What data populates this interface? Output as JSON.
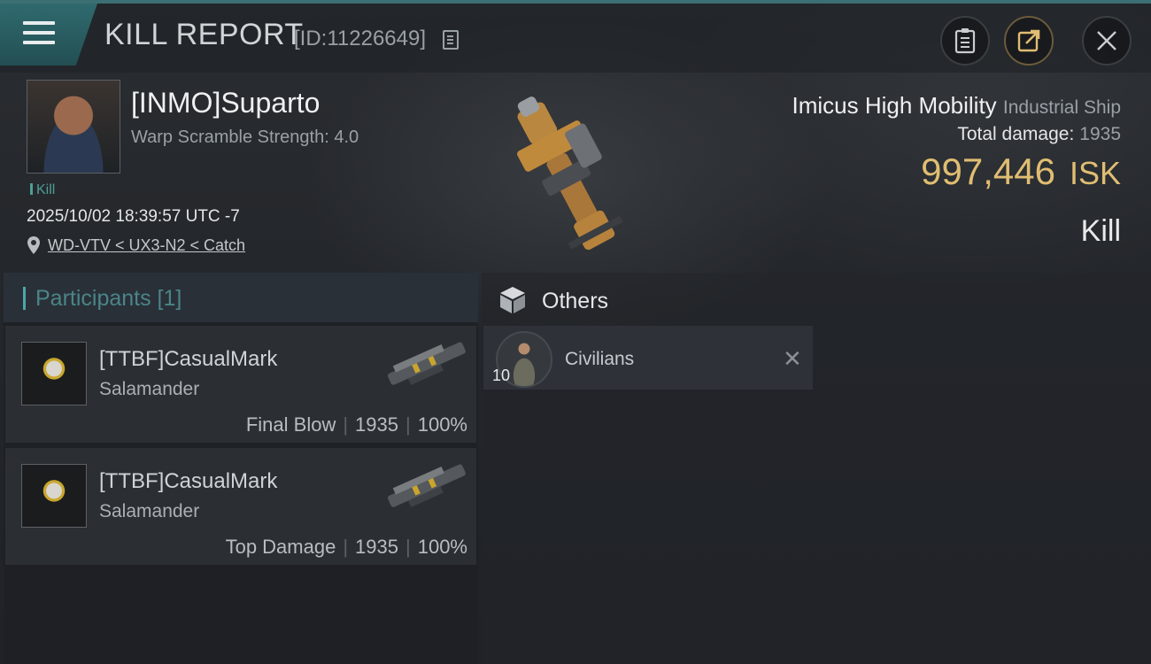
{
  "header": {
    "title": "KILL REPORT",
    "report_id": "[ID:11226649]"
  },
  "victim": {
    "name": "[INMO]Suparto",
    "warp_scramble": "Warp Scramble Strength: 4.0",
    "kill_tag": "Kill",
    "datetime": "2025/10/02 18:39:57 UTC -7",
    "location": "WD-VTV < UX3-N2 < Catch"
  },
  "ship": {
    "name": "Imicus High Mobility",
    "class": "Industrial Ship",
    "total_damage_label": "Total damage:",
    "total_damage_value": "1935",
    "isk_value": "997,446",
    "isk_unit": "ISK",
    "result": "Kill"
  },
  "participants": {
    "tab_label": "Participants [1]",
    "rows": [
      {
        "name": "[TTBF]CasualMark",
        "ship": "Salamander",
        "role": "Final Blow",
        "damage": "1935",
        "percent": "100%"
      },
      {
        "name": "[TTBF]CasualMark",
        "ship": "Salamander",
        "role": "Top Damage",
        "damage": "1935",
        "percent": "100%"
      }
    ]
  },
  "others": {
    "title": "Others",
    "items": [
      {
        "name": "Civilians",
        "qty": "10"
      }
    ]
  },
  "colors": {
    "accent_teal": "#4fa6a7",
    "isk_gold": "#e0bd72"
  },
  "icons": [
    "menu-icon",
    "copy-icon",
    "clipboard-icon",
    "share-icon",
    "close-icon",
    "location-pin-icon",
    "cube-icon",
    "remove-icon"
  ]
}
